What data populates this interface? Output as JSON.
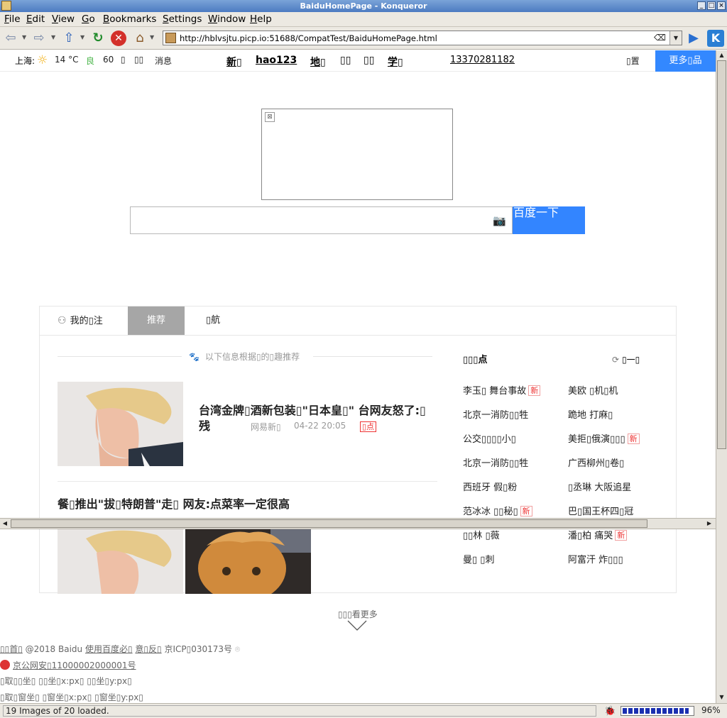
{
  "window": {
    "title": "BaiduHomePage - Konqueror"
  },
  "menu": [
    "File",
    "Edit",
    "View",
    "Go",
    "Bookmarks",
    "Settings",
    "Window",
    "Help"
  ],
  "toolbar": {
    "url": "http://hblvsjtu.picp.io:51688/CompatTest/BaiduHomePage.html",
    "icons": [
      "back-icon",
      "forward-icon",
      "up-icon",
      "reload-icon",
      "stop-icon",
      "home-icon",
      "clear-location-icon",
      "go-icon",
      "kde-logo"
    ]
  },
  "topnav": {
    "city": "上海:",
    "temperature": "14 °C",
    "air_quality_label": "良",
    "air_quality_value": "60",
    "small_links": [
      "▯",
      "▯▯",
      "消息"
    ],
    "main_links": [
      "新▯",
      "hao123",
      "地▯",
      "▯▯",
      "▯▯",
      "学▯"
    ],
    "phone": "13370281182",
    "settings": "▯置",
    "more_products": "更多▯品"
  },
  "search": {
    "button_label": "百度一下",
    "value": ""
  },
  "tabs": [
    "我的▯注",
    "推荐",
    "▯航"
  ],
  "feed": {
    "note": "以下信息根据▯的▯趣推荐",
    "item1": {
      "title": "台湾金牌▯酒新包装▯\"日本皇▯\" 台网友怒了:▯残",
      "source": "网易新▯",
      "time": "04-22 20:05",
      "tag": "▯点"
    },
    "item2": {
      "title": "餐▯推出\"拔▯特朗普\"走▯ 网友:点菜率一定很高"
    }
  },
  "hot": {
    "title": "▯▯▯点",
    "refresh": "▯一▯",
    "new_badge": "新",
    "items": [
      {
        "text": "李玉▯ 舞台事故",
        "is_new": true
      },
      {
        "text": "美欧 ▯机▯机",
        "is_new": false
      },
      {
        "text": "北京一消防▯▯牲",
        "is_new": false
      },
      {
        "text": "跪地 打麻▯",
        "is_new": false
      },
      {
        "text": "公交▯▯▯▯小▯",
        "is_new": false
      },
      {
        "text": "美拒▯俄演▯▯▯",
        "is_new": true
      },
      {
        "text": "北京一消防▯▯牲",
        "is_new": false
      },
      {
        "text": "广西柳州▯卷▯",
        "is_new": false
      },
      {
        "text": "西班牙 假▯粉",
        "is_new": false
      },
      {
        "text": "▯丞琳 大阪追星",
        "is_new": false
      },
      {
        "text": "范冰冰 ▯▯秘▯",
        "is_new": true
      },
      {
        "text": "巴▯国王杯四▯冠",
        "is_new": false
      },
      {
        "text": "▯▯林 ▯薇",
        "is_new": false
      },
      {
        "text": "潘▯柏 痛哭",
        "is_new": true
      },
      {
        "text": "曼▯ ▯刺",
        "is_new": false
      },
      {
        "text": "阿富汗 炸▯▯▯",
        "is_new": false
      }
    ]
  },
  "load_more": "▯▯▯看更多",
  "footer": {
    "line1_a": "▯▯首▯",
    "line1_b": "@2018 Baidu",
    "line1_c": "使用百度必▯",
    "line1_d": "意▯反▯",
    "line1_e": "京ICP▯030173号",
    "line2": "京公网安▯11000002000001号",
    "line3": "▯取▯▯坐▯ ▯▯坐▯x:px▯ ▯▯坐▯y:px▯",
    "line4": "▯取▯窗坐▯ ▯窗坐▯x:px▯ ▯窗坐▯y:px▯"
  },
  "status": {
    "message": "19 Images of 20 loaded.",
    "zoom": "96%",
    "progress": 0.95
  }
}
